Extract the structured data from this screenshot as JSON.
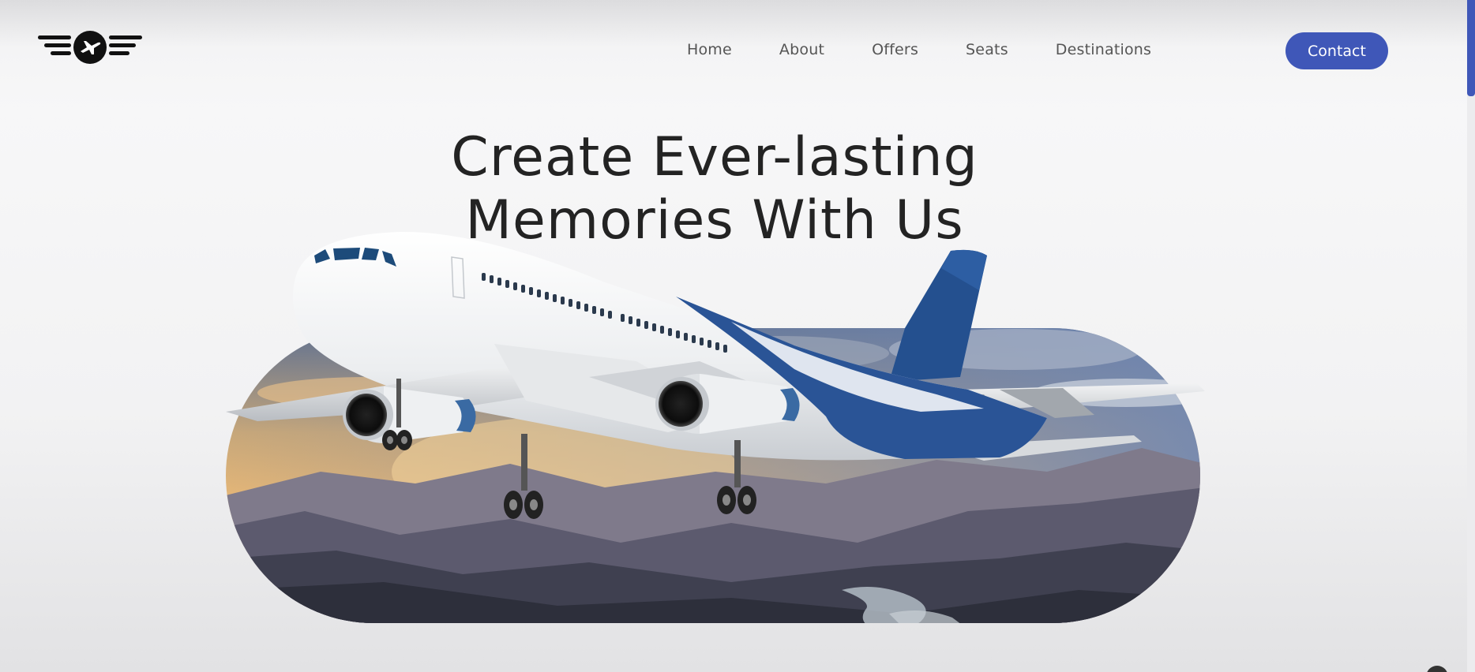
{
  "nav": {
    "home": "Home",
    "about": "About",
    "offers": "Offers",
    "seats": "Seats",
    "destinations": "Destinations"
  },
  "contact_label": "Contact",
  "hero": {
    "line1": "Create Ever-lasting",
    "line2": "Memories With Us"
  },
  "icons": {
    "logo": "winged-plane-logo-icon"
  },
  "colors": {
    "accent": "#3f57b8",
    "heading": "#232323",
    "nav_text": "#555555",
    "plane_livery": "#2a5496"
  }
}
